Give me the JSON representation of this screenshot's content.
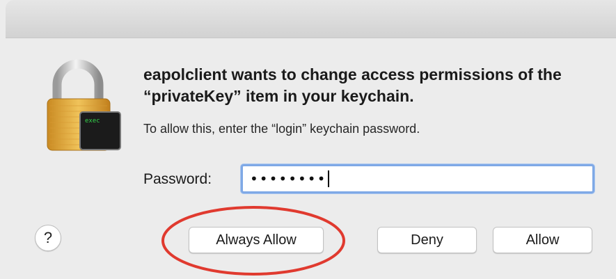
{
  "dialog": {
    "title": "eapolclient wants to change access permissions of the “privateKey” item in your keychain.",
    "subtitle": "To allow this, enter the “login” keychain password.",
    "password_label": "Password:",
    "password_value": "••••••••",
    "app_icon_text": "exec"
  },
  "buttons": {
    "help": "?",
    "always_allow": "Always Allow",
    "deny": "Deny",
    "allow": "Allow"
  },
  "colors": {
    "background": "#ececec",
    "lock_gold": "#e2a63a",
    "focus_ring": "#7fa9e6",
    "annotation_red": "#e03a2f",
    "terminal_text": "#33d14a"
  },
  "icons": {
    "lock": "keychain-lock-icon",
    "terminal": "terminal-exec-icon"
  }
}
